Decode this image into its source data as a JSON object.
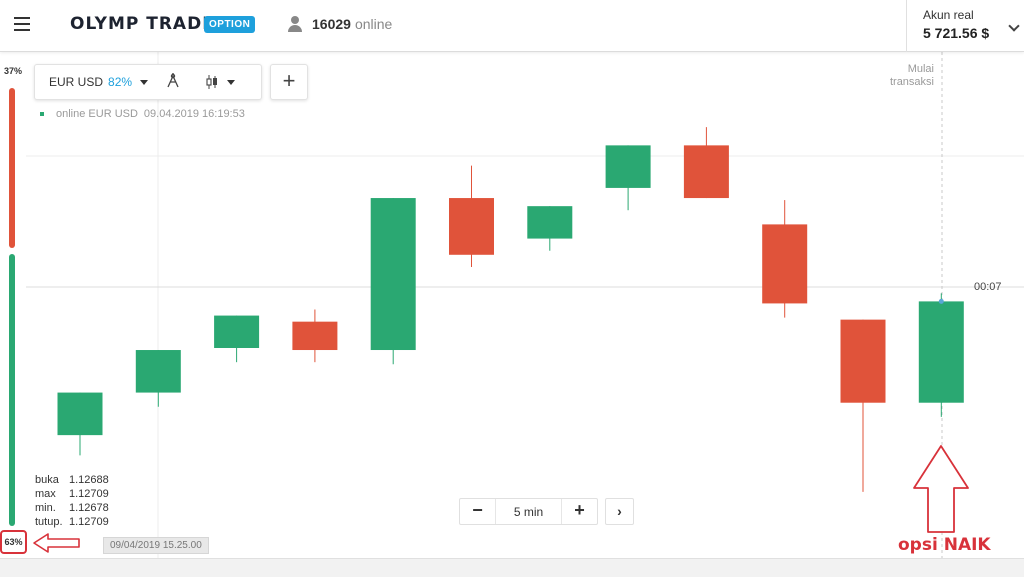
{
  "header": {
    "logo_text": "OLYMP TRADE",
    "badge": "OPTION",
    "online_count": "16029",
    "online_label": "online",
    "account_label": "Akun real",
    "account_balance": "5 721.56 $"
  },
  "sentiment": {
    "down_pct": "37%",
    "up_pct": "63%",
    "down_fraction": 0.37,
    "up_fraction": 0.63
  },
  "toolbar": {
    "pair": "EUR USD",
    "payout": "82%",
    "add_symbol": "+"
  },
  "live": {
    "label": "online EUR USD",
    "timestamp": "09.04.2019 16:19:53"
  },
  "chart": {
    "start_label": "Mulai transaksi",
    "timer": "00:07",
    "date_badge": "09/04/2019 15.25.00",
    "timeframe": "5 min",
    "colors": {
      "up": "#2aa872",
      "down": "#e0533a"
    },
    "ohlc": [
      {
        "label": "buka",
        "value": "1.12688"
      },
      {
        "label": "max",
        "value": "1.12709"
      },
      {
        "label": "min.",
        "value": "1.12678"
      },
      {
        "label": "tutup.",
        "value": "1.12709"
      }
    ]
  },
  "annotation": {
    "label": "opsi NAIK"
  },
  "chart_data": {
    "type": "candlestick",
    "title": "",
    "series": [
      {
        "o": 1.12688,
        "h": 1.12688,
        "l": 1.12678,
        "c": 1.12709
      },
      {
        "o": 1.12709,
        "h": 1.12709,
        "l": 1.12702,
        "c": 1.1273
      },
      {
        "o": 1.12731,
        "h": 1.12743,
        "l": 1.12724,
        "c": 1.12747
      },
      {
        "o": 1.12744,
        "h": 1.1275,
        "l": 1.12724,
        "c": 1.1273
      },
      {
        "o": 1.1273,
        "h": 1.12805,
        "l": 1.12723,
        "c": 1.12805
      },
      {
        "o": 1.12805,
        "h": 1.12821,
        "l": 1.12771,
        "c": 1.12777
      },
      {
        "o": 1.12785,
        "h": 1.12797,
        "l": 1.12779,
        "c": 1.12801
      },
      {
        "o": 1.1281,
        "h": 1.12814,
        "l": 1.12799,
        "c": 1.12831
      },
      {
        "o": 1.12831,
        "h": 1.1284,
        "l": 1.12806,
        "c": 1.12805
      },
      {
        "o": 1.12792,
        "h": 1.12804,
        "l": 1.12746,
        "c": 1.12753
      },
      {
        "o": 1.12745,
        "h": 1.12745,
        "l": 1.1266,
        "c": 1.12704
      },
      {
        "o": 1.12704,
        "h": 1.12758,
        "l": 1.12697,
        "c": 1.12754
      }
    ],
    "current_price_candle": 11
  }
}
